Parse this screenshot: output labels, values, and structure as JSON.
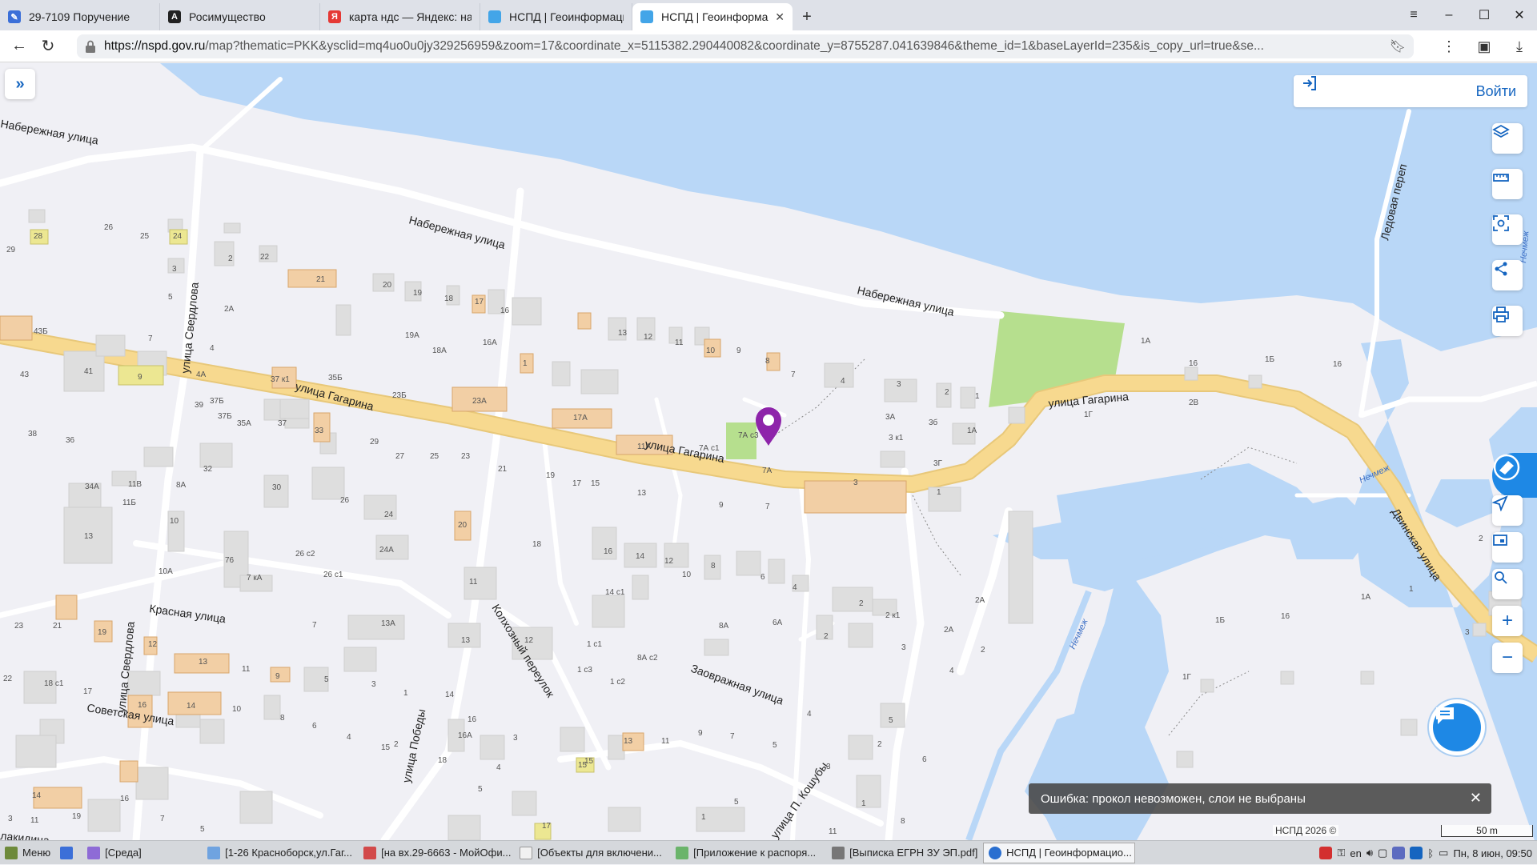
{
  "browser": {
    "tabs": [
      {
        "title": "29-7109 Поручение",
        "active": false
      },
      {
        "title": "Росимущество",
        "active": false
      },
      {
        "title": "карта ндс — Яндекс: нашлось",
        "active": false
      },
      {
        "title": "НСПД | Геоинформационная",
        "active": false
      },
      {
        "title": "НСПД | Геоинформаци",
        "active": true
      }
    ],
    "new_tab": "+",
    "url_host": "https://nspd.gov.ru",
    "url_path": "/map?thematic=PKK&ysclid=mq4uo0u0jy329256959&zoom=17&coordinate_x=5115382.290440082&coordinate_y=8755287.041639846&theme_id=1&baseLayerId=235&is_copy_url=true&se..."
  },
  "map": {
    "login_label": "Войти",
    "streets": {
      "gagarina": "улица Гагарина",
      "naberezhnaya": "Набережная улица",
      "sverdlova": "улица Свердлова",
      "krasnaya": "Красная улица",
      "sovetskaya": "Советская улица",
      "kolkhozny": "Колхозный переулок",
      "zaovrazhnaya": "Заовражная улица",
      "pobedy": "улица Победы",
      "koshuby": "улица П. Кошубы",
      "dvinskaya": "Двинская улица",
      "ledovaya": "Ледовая переп",
      "plakidina": "лакидина"
    },
    "river_label": "Нечмеж",
    "buildings": {
      "b28": "28",
      "b24": "24",
      "b26": "26",
      "b25": "25",
      "b29": "29",
      "b3": "3",
      "b5": "5",
      "b2": "2",
      "b22": "22",
      "b21": "21",
      "b20": "20",
      "b19": "19",
      "b18": "18",
      "b17": "17",
      "b16": "16",
      "b2a": "2А",
      "b43b": "43Б",
      "b7": "7",
      "b4": "4",
      "b19a": "19А",
      "b18a": "18А",
      "b16a": "16А",
      "b1": "1",
      "b43": "43",
      "b41": "41",
      "b9": "9",
      "b4a": "4А",
      "b37k1": "37 к1",
      "b35b": "35Б",
      "b23b": "23Б",
      "b23a": "23А",
      "b17a": "17А",
      "b13": "13",
      "b12": "12",
      "b11": "11",
      "b10": "10",
      "b8": "8",
      "b7a": "7А",
      "b7ac3": "7А с3",
      "b7ac1": "7А с1",
      "b11a": "11А",
      "b39": "39",
      "b37b": "37Б",
      "b35a": "35А",
      "b37": "37",
      "b33": "33",
      "b38": "38",
      "b36": "36",
      "b27": "27",
      "b32": "32",
      "b34a": "34А",
      "b11b": "11В",
      "b11bb": "11Б",
      "b8a": "8А",
      "b30": "30",
      "b3a": "3А",
      "b3b": "3б",
      "b3k1": "3 к1",
      "b3g": "3Г",
      "b1a": "1А",
      "b1b": "1Б",
      "b16b": "16",
      "b1g": "1Г",
      "b2b": "2В",
      "b15": "15",
      "b14": "14",
      "b14c1": "14 с1",
      "b6": "6",
      "b6a": "6А",
      "b2k1": "2 к1",
      "b1c1": "1 с1",
      "b1c3": "1 с3",
      "b1c2": "1 с2",
      "b8ac2": "8А с2",
      "b13a": "13А",
      "b26c2": "26 с2",
      "b26c1": "26 с1",
      "b24a": "24А",
      "b76": "76",
      "b7ka": "7 кА",
      "b10a": "10А",
      "b23": "23",
      "b18c1": "18 с1"
    }
  },
  "tools": [
    "layers-icon",
    "ruler-icon",
    "scan-icon",
    "share-icon",
    "print-icon"
  ],
  "right_tools_bottom": [
    "navigate-icon",
    "screen-icon",
    "locate-icon",
    "zoom-in-icon",
    "zoom-out-icon"
  ],
  "zoom_in": "+",
  "zoom_out": "−",
  "toast": {
    "text": "Ошибка: прокол невозможен, слои не выбраны",
    "close": "✕"
  },
  "copyright": "НСПД 2026 ©",
  "scale": "50 m",
  "taskbar": {
    "menu": "Меню",
    "items": [
      {
        "label": "[Среда]"
      },
      {
        "label": "[1-26 Красноборск,ул.Гаг..."
      },
      {
        "label": "[на вх.29-6663 - МойОфи..."
      },
      {
        "label": "[Объекты для включени..."
      },
      {
        "label": "[Приложение к распоря..."
      },
      {
        "label": "[Выписка ЕГРН ЗУ ЭП.pdf]"
      },
      {
        "label": "НСПД | Геоинформацио..."
      }
    ],
    "lang": "en",
    "datetime": "Пн, 8 июн, 09:50"
  },
  "colors": {
    "accent": "#1e88e5",
    "road": "#f7d98f",
    "water": "#b9d7f7",
    "park": "#b6df8e",
    "building": "#dedede",
    "building_orange": "#f2cfa5",
    "pin": "#8e24aa"
  }
}
